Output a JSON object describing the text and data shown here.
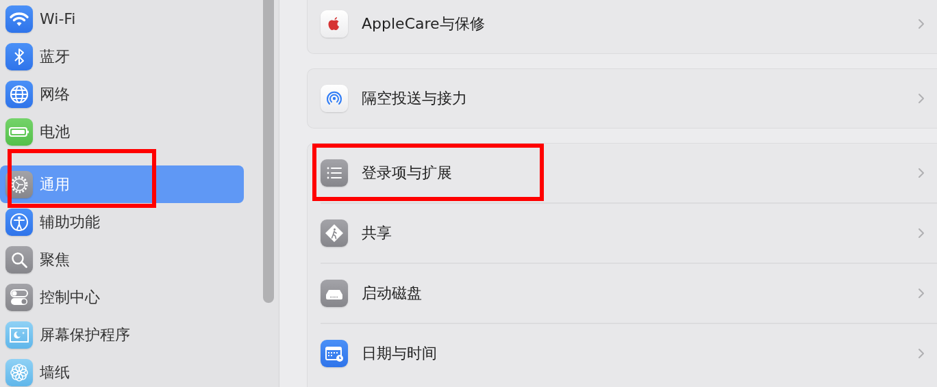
{
  "sidebar": {
    "groups": [
      {
        "items": [
          {
            "label": "Wi-Fi",
            "kind": "wifi",
            "selected": false,
            "annotated": false
          },
          {
            "label": "蓝牙",
            "kind": "bluetooth",
            "selected": false,
            "annotated": false
          },
          {
            "label": "网络",
            "kind": "globe",
            "selected": false,
            "annotated": false
          },
          {
            "label": "电池",
            "kind": "battery",
            "selected": false,
            "annotated": false
          }
        ]
      },
      {
        "items": [
          {
            "label": "通用",
            "kind": "gear",
            "selected": true,
            "annotated": true
          },
          {
            "label": "辅助功能",
            "kind": "accessibility",
            "selected": false,
            "annotated": false
          },
          {
            "label": "聚焦",
            "kind": "search",
            "selected": false,
            "annotated": false
          },
          {
            "label": "控制中心",
            "kind": "toggles",
            "selected": false,
            "annotated": false
          },
          {
            "label": "屏幕保护程序",
            "kind": "screensaver",
            "selected": false,
            "annotated": false
          },
          {
            "label": "墙纸",
            "kind": "flower",
            "selected": false,
            "annotated": false
          }
        ]
      }
    ]
  },
  "content": {
    "cards": [
      {
        "rows": [
          {
            "label": "AppleCare与保修",
            "kind": "apple",
            "annotated": false
          }
        ]
      },
      {
        "rows": [
          {
            "label": "隔空投送与接力",
            "kind": "airdrop",
            "annotated": false
          }
        ]
      },
      {
        "rows": [
          {
            "label": "登录项与扩展",
            "kind": "list",
            "annotated": true
          },
          {
            "label": "共享",
            "kind": "sharing",
            "annotated": false
          },
          {
            "label": "启动磁盘",
            "kind": "disk",
            "annotated": false
          },
          {
            "label": "日期与时间",
            "kind": "calendar",
            "annotated": false
          }
        ]
      }
    ]
  }
}
